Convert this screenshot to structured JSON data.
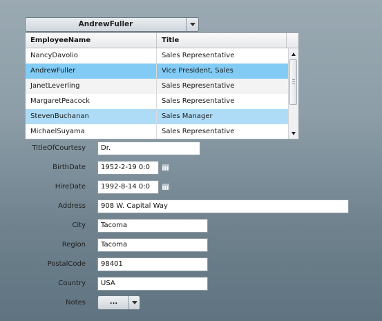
{
  "selector": {
    "value": "AndrewFuller"
  },
  "grid": {
    "columns": [
      "EmployeeName",
      "Title"
    ],
    "rows": [
      {
        "name": "NancyDavolio",
        "title": "Sales Representative"
      },
      {
        "name": "AndrewFuller",
        "title": "Vice President, Sales"
      },
      {
        "name": "JanetLeverling",
        "title": "Sales Representative"
      },
      {
        "name": "MargaretPeacock",
        "title": "Sales Representative"
      },
      {
        "name": "StevenBuchanan",
        "title": "Sales Manager"
      },
      {
        "name": "MichaelSuyama",
        "title": "Sales Representative"
      }
    ],
    "selected_row": 1,
    "hover_row": 4
  },
  "form": {
    "title_of_courtesy": {
      "label": "TitleOfCourtesy",
      "value": "Dr."
    },
    "birth_date": {
      "label": "BirthDate",
      "value": "1952-2-19 0:0"
    },
    "hire_date": {
      "label": "HireDate",
      "value": "1992-8-14 0:0"
    },
    "address": {
      "label": "Address",
      "value": "908 W. Capital Way"
    },
    "city": {
      "label": "City",
      "value": "Tacoma"
    },
    "region": {
      "label": "Region",
      "value": "Tacoma"
    },
    "postal_code": {
      "label": "PostalCode",
      "value": "98401"
    },
    "country": {
      "label": "Country",
      "value": "USA"
    },
    "notes": {
      "label": "Notes",
      "button_label": "..."
    }
  },
  "colors": {
    "selected_row": "#82cbf5",
    "hover_row": "#aedcf7"
  },
  "icons": {
    "date_picker": "calendar-icon",
    "dropdown": "chevron-down-icon"
  }
}
